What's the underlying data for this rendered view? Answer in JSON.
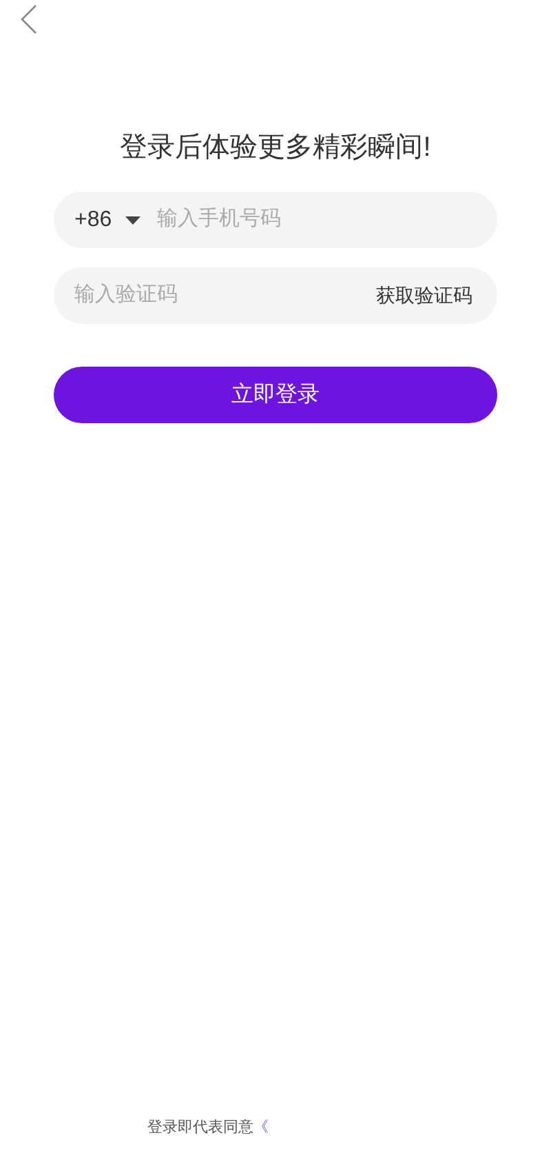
{
  "title": "登录后体验更多精彩瞬间!",
  "phone_field": {
    "country_code": "+86",
    "placeholder": "输入手机号码"
  },
  "code_field": {
    "placeholder": "输入验证码",
    "action": "获取验证码"
  },
  "login_button": "立即登录",
  "terms": {
    "text": "登录即代表同意",
    "link": "《"
  }
}
